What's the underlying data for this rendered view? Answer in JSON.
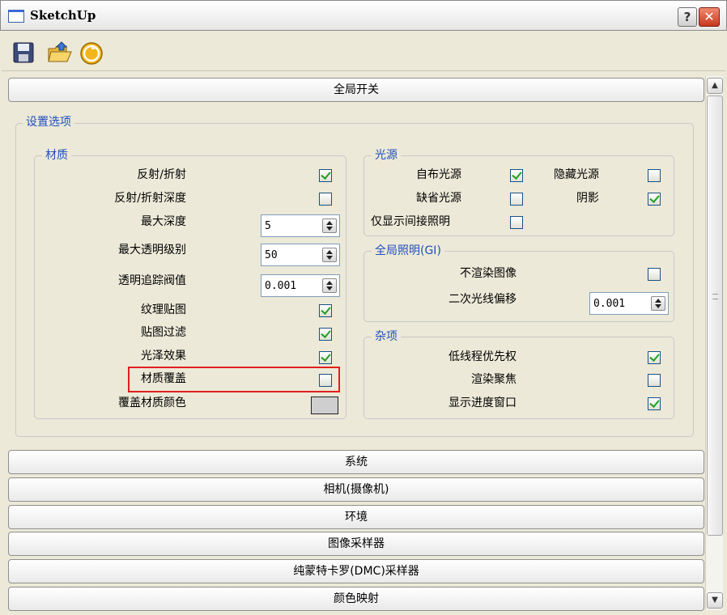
{
  "window": {
    "title": "SketchUp",
    "help_label": "?",
    "close_label": "✕"
  },
  "toolbar": {
    "tools": [
      "save-icon",
      "open-folder-icon",
      "render-icon"
    ]
  },
  "sections": {
    "global_switch": "全局开关",
    "system": "系统",
    "camera": "相机(摄像机)",
    "environment": "环境",
    "image_sampler": "图像采样器",
    "dmc_sampler": "纯蒙特卡罗(DMC)采样器",
    "color_mapping": "颜色映射"
  },
  "settings": {
    "legend": "设置选项"
  },
  "material": {
    "legend": "材质",
    "reflection_refraction": {
      "label": "反射/折射",
      "checked": true
    },
    "reflection_refraction_depth": {
      "label": "反射/折射深度",
      "checked": false
    },
    "max_depth": {
      "label": "最大深度",
      "value": "5"
    },
    "max_transparency_levels": {
      "label": "最大透明级别",
      "value": "50"
    },
    "transparency_cutoff": {
      "label": "透明追踪阀值",
      "value": "0.001"
    },
    "texture_maps": {
      "label": "纹理贴图",
      "checked": true
    },
    "filter_maps": {
      "label": "贴图过滤",
      "checked": true
    },
    "glossy_effects": {
      "label": "光泽效果",
      "checked": true
    },
    "override_material": {
      "label": "材质覆盖",
      "checked": false
    },
    "override_color": {
      "label": "覆盖材质颜色",
      "color": "#cfcfcf"
    }
  },
  "lights": {
    "legend": "光源",
    "custom_lights": {
      "label": "自布光源",
      "checked": true
    },
    "hidden_lights": {
      "label": "隐藏光源",
      "checked": false
    },
    "default_lights": {
      "label": "缺省光源",
      "checked": false
    },
    "shadows": {
      "label": "阴影",
      "checked": true
    },
    "show_gi_only": {
      "label": "仅显示间接照明",
      "checked": false
    }
  },
  "gi": {
    "legend": "全局照明(GI)",
    "dont_render_image": {
      "label": "不渲染图像",
      "checked": false
    },
    "secondary_ray_bias": {
      "label": "二次光线偏移",
      "value": "0.001"
    }
  },
  "misc": {
    "legend": "杂项",
    "low_thread_priority": {
      "label": "低线程优先权",
      "checked": true
    },
    "render_focus": {
      "label": "渲染聚焦",
      "checked": false
    },
    "show_progress_window": {
      "label": "显示进度窗口",
      "checked": true
    }
  },
  "colors": {
    "highlight": "#e02020",
    "legend_text": "#1f4fbf",
    "check": "#21a121"
  }
}
